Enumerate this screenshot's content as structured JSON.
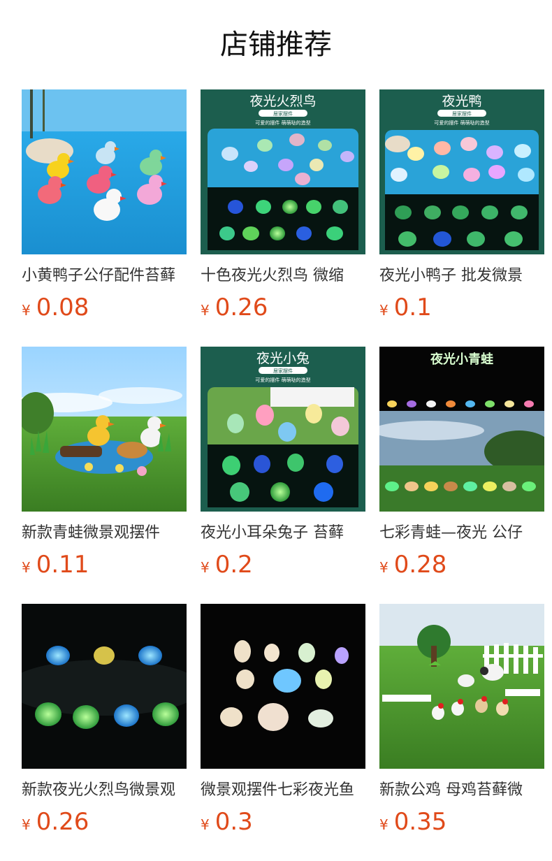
{
  "page_title": "店铺推荐",
  "currency_symbol": "¥",
  "accent_color": "#e04a1a",
  "products": [
    {
      "name": "小黄鸭子公仔配件苔藓",
      "price": "0.08",
      "image": "resin-ducks-on-blue-sand"
    },
    {
      "name": "十色夜光火烈鸟 微缩",
      "price": "0.26",
      "image": "glow-flamingo-banner",
      "banner_title": "夜光火烈鸟",
      "banner_badge": "居家摆件",
      "banner_subtitle": "可爱的摆件  萌萌哒的造型"
    },
    {
      "name": "夜光小鸭子 批发微景",
      "price": "0.1",
      "image": "glow-duck-banner",
      "banner_title": "夜光鸭",
      "banner_badge": "居家摆件",
      "banner_subtitle": "可爱的摆件  萌萌哒的造型"
    },
    {
      "name": "新款青蛙微景观摆件",
      "price": "0.11",
      "image": "ducks-on-grass-pond"
    },
    {
      "name": "夜光小耳朵兔子 苔藓",
      "price": "0.2",
      "image": "glow-rabbit-banner",
      "banner_title": "夜光小兔",
      "banner_badge": "居家摆件",
      "banner_subtitle": "可爱的摆件  萌萌哒的造型"
    },
    {
      "name": "七彩青蛙—夜光 公仔",
      "price": "0.28",
      "image": "glow-frog-banner",
      "banner_title": "夜光小青蛙"
    },
    {
      "name": "新款夜光火烈鸟微景观",
      "price": "0.26",
      "image": "glowing-ducks-dark"
    },
    {
      "name": "微景观摆件七彩夜光鱼",
      "price": "0.3",
      "image": "glowing-sea-animals-dark"
    },
    {
      "name": "新款公鸡 母鸡苔藓微",
      "price": "0.35",
      "image": "farm-chickens-on-grass"
    }
  ]
}
